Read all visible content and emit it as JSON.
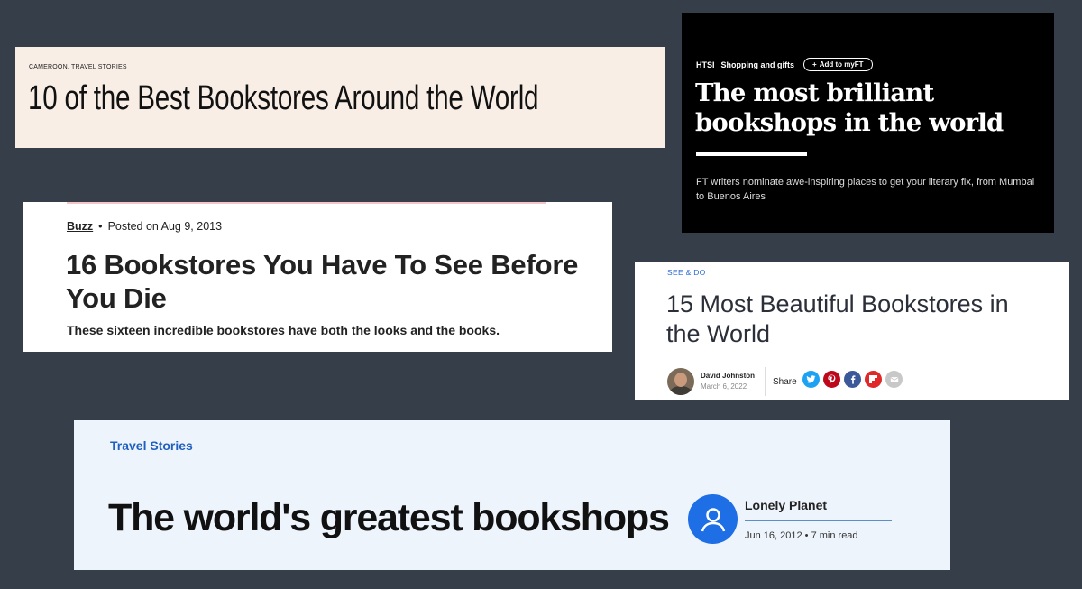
{
  "card1": {
    "category": "CAMEROON, TRAVEL STORIES",
    "title": "10 of the Best Bookstores Around the World"
  },
  "card2": {
    "section": "HTSI",
    "subsection": "Shopping and gifts",
    "add_button": "Add to myFT",
    "title": "The most brilliant bookshops in the world",
    "description": "FT writers nominate awe-inspiring places to get your literary fix, from Mumbai to Buenos Aires"
  },
  "card3": {
    "category": "Buzz",
    "separator": "•",
    "posted": "Posted on Aug 9, 2013",
    "title": "16 Bookstores You Have To See Before You Die",
    "subtitle": "These sixteen incredible bookstores have both the looks and the books."
  },
  "card4": {
    "category": "SEE & DO",
    "title": "15 Most Beautiful Bookstores in the World",
    "author": "David Johnston",
    "date": "March 6, 2022",
    "share_label": "Share",
    "share_icons": [
      {
        "name": "twitter-icon",
        "color": "#1da1f2"
      },
      {
        "name": "pinterest-icon",
        "color": "#bd081c"
      },
      {
        "name": "facebook-icon",
        "color": "#3b5998"
      },
      {
        "name": "flipboard-icon",
        "color": "#e12828"
      },
      {
        "name": "email-icon",
        "color": "#c8c8c8"
      }
    ]
  },
  "card5": {
    "category": "Travel Stories",
    "title": "The world's greatest bookshops",
    "author": "Lonely Planet",
    "date": "Jun 16, 2012 • 7 min read"
  }
}
